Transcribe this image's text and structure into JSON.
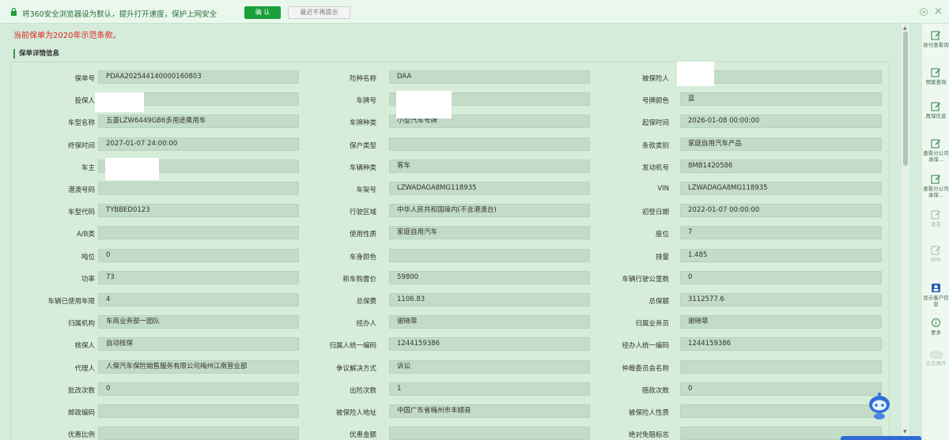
{
  "notice": {
    "text": "将360安全浏览器设为默认，提升打开速度，保护上网安全",
    "ok_label": "确 认",
    "never_label": "最近不再提示"
  },
  "red_note": "当前保单为2020年示范条款。",
  "section_title": "保单详情信息",
  "rows": [
    [
      [
        "保单号",
        "PDAA202544140000160803"
      ],
      [
        "险种名称",
        "DAA"
      ],
      [
        "被保险人",
        ""
      ]
    ],
    [
      [
        "投保人",
        ""
      ],
      [
        "车牌号",
        ""
      ],
      [
        "号牌颜色",
        "蓝"
      ]
    ],
    [
      [
        "车型名称",
        "五菱LZW6449GB6多用途乘用车"
      ],
      [
        "车牌种类",
        "小型汽车号牌"
      ],
      [
        "起保时间",
        "2026-01-08 00:00:00"
      ]
    ],
    [
      [
        "终保时间",
        "2027-01-07 24:00:00"
      ],
      [
        "保户类型",
        ""
      ],
      [
        "条款类别",
        "家庭自用汽车产品"
      ]
    ],
    [
      [
        "车主",
        ""
      ],
      [
        "车辆种类",
        "客车"
      ],
      [
        "发动机号",
        "8MB1420586"
      ]
    ],
    [
      [
        "港澳号码",
        ""
      ],
      [
        "车架号",
        "LZWADAGA8MG118935"
      ],
      [
        "VIN",
        "LZWADAGA8MG118935"
      ]
    ],
    [
      [
        "车型代码",
        "TYBBED0123"
      ],
      [
        "行驶区域",
        "中华人民共和国境内(不含港澳台)"
      ],
      [
        "初登日期",
        "2022-01-07 00:00:00"
      ]
    ],
    [
      [
        "A/B类",
        ""
      ],
      [
        "使用性质",
        "家庭自用汽车"
      ],
      [
        "座位",
        "7"
      ]
    ],
    [
      [
        "吨位",
        "0"
      ],
      [
        "车身颜色",
        ""
      ],
      [
        "排量",
        "1.485"
      ]
    ],
    [
      [
        "功率",
        "73"
      ],
      [
        "新车购置价",
        "59800"
      ],
      [
        "车辆行驶公里数",
        "0"
      ]
    ],
    [
      [
        "车辆已使用年限",
        "4"
      ],
      [
        "总保费",
        "1106.83"
      ],
      [
        "总保额",
        "3112577.6"
      ]
    ],
    [
      [
        "归属机构",
        "车商业务部一团队"
      ],
      [
        "经办人",
        "谢晓菲"
      ],
      [
        "归属业务员",
        "谢晓菲"
      ]
    ],
    [
      [
        "核保人",
        "自动核保"
      ],
      [
        "归属人统一编码",
        "1244159386"
      ],
      [
        "经办人统一编码",
        "1244159386"
      ]
    ],
    [
      [
        "代理人",
        "人保汽车保险销售服务有限公司梅州江南营业部"
      ],
      [
        "争议解决方式",
        "诉讼"
      ],
      [
        "仲裁委员会名称",
        ""
      ]
    ],
    [
      [
        "批改次数",
        "0"
      ],
      [
        "出险次数",
        "1"
      ],
      [
        "赔款次数",
        "0"
      ]
    ],
    [
      [
        "邮政编码",
        ""
      ],
      [
        "被保险人地址",
        "中国广东省梅州市丰顺县"
      ],
      [
        "被保险人性质",
        ""
      ]
    ],
    [
      [
        "优惠比例",
        ""
      ],
      [
        "优惠金额",
        ""
      ],
      [
        "绝对免赔标志",
        ""
      ]
    ]
  ],
  "sidebar": [
    {
      "label": "收付查看询",
      "icon": "edit-icon"
    },
    {
      "label": "预案查询",
      "icon": "edit-icon"
    },
    {
      "label": "再保信息",
      "icon": "edit-icon"
    },
    {
      "label": "查看分公司承保...",
      "icon": "edit-icon"
    },
    {
      "label": "查看分公司承保...",
      "icon": "edit-icon"
    },
    {
      "label": "查看",
      "icon": "edit-icon"
    },
    {
      "label": "邮件",
      "icon": "edit-icon"
    },
    {
      "label": "显示客户信息",
      "icon": "person-icon"
    },
    {
      "label": "更多",
      "icon": "info-icon"
    },
    {
      "label": "点击展开",
      "icon": "toggle-icon"
    }
  ]
}
